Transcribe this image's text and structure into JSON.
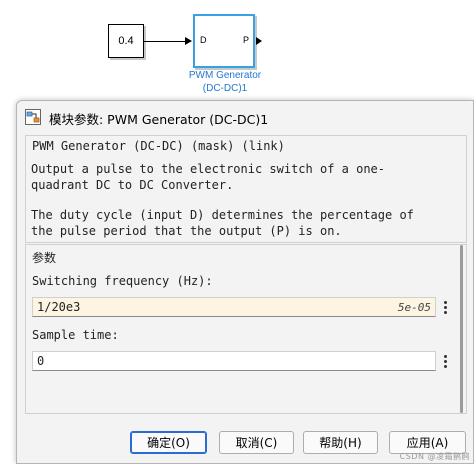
{
  "canvas": {
    "constant_block_value": "0.4",
    "pwm_block": {
      "input_port": "D",
      "output_port": "P",
      "name_line1": "PWM Generator",
      "name_line2": "(DC-DC)1",
      "selection_color": "#3aa0e6",
      "name_color": "#1f77d0"
    }
  },
  "dialog": {
    "title": "模块参数: PWM Generator (DC-DC)1",
    "header": "PWM Generator (DC-DC) (mask) (link)",
    "description_1": "Output a pulse to the electronic switch of a one-\nquadrant DC to DC Converter.",
    "description_2": "The duty cycle (input D) determines the percentage of\nthe pulse period that the output (P) is on.",
    "params_legend": "参数",
    "params": [
      {
        "label": "Switching frequency (Hz):",
        "value": "1/20e3",
        "evaluated": "5e-05"
      },
      {
        "label": "Sample time:",
        "value": "0"
      }
    ],
    "buttons": {
      "ok": "确定(O)",
      "cancel": "取消(C)",
      "help": "帮助(H)",
      "apply": "应用(A)"
    }
  },
  "watermark": "CSDN @凌霜鹊鸥",
  "colors": {
    "dialog_bg": "#f3f3f3",
    "edited_field_bg": "#fdf5e1",
    "default_button_border": "#2b6cd4"
  }
}
